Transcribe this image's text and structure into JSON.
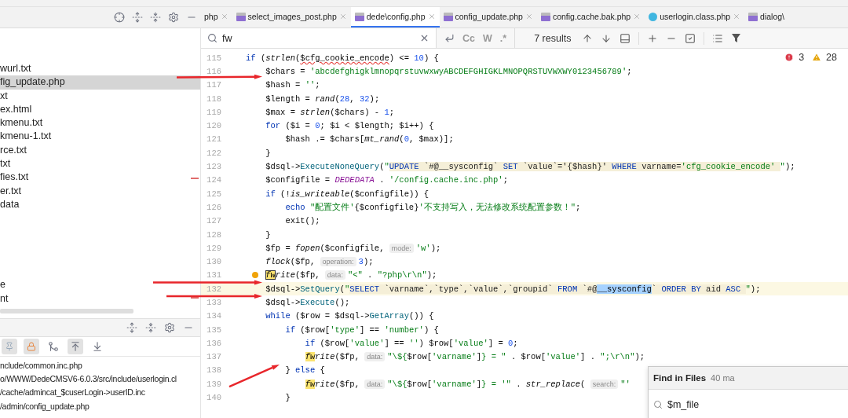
{
  "tabs": [
    {
      "label": "php",
      "selected": false
    },
    {
      "label": "select_images_post.php",
      "kind": "php",
      "selected": false
    },
    {
      "label": "dede\\config.php",
      "kind": "php",
      "selected": true
    },
    {
      "label": "config_update.php",
      "kind": "php",
      "selected": false
    },
    {
      "label": "config.cache.bak.php",
      "kind": "php",
      "selected": false
    },
    {
      "label": "userlogin.class.php",
      "kind": "class",
      "selected": false
    },
    {
      "label": "dialog\\",
      "kind": "php",
      "selected": false
    }
  ],
  "find_bar": {
    "query": "fw",
    "options": [
      "Cc",
      "W",
      ".*"
    ],
    "results": "7 results"
  },
  "inspections": {
    "errors": "3",
    "warnings": "28"
  },
  "project_files": {
    "items": [
      {
        "label": "wurl.txt",
        "selected": false
      },
      {
        "label": "fig_update.php",
        "selected": true
      },
      {
        "label": "xt",
        "selected": false
      },
      {
        "label": "ex.html",
        "selected": false
      },
      {
        "label": "kmenu.txt",
        "selected": false
      },
      {
        "label": "kmenu-1.txt",
        "selected": false
      },
      {
        "label": "rce.txt",
        "selected": false
      },
      {
        "label": "txt",
        "selected": false
      },
      {
        "label": "fies.txt",
        "selected": false
      },
      {
        "label": "er.txt",
        "selected": false
      },
      {
        "label": "data",
        "selected": false
      }
    ],
    "more_items": [
      {
        "label": "e",
        "selected": false
      },
      {
        "label": "nt",
        "selected": false
      }
    ]
  },
  "find_results": {
    "items": [
      "nclude/common.inc.php",
      "o/WWW/DedeCMSV6-6.0.3/src/include/userlogin.cl",
      "/cache/admincat_$cuserLogin->userID.inc",
      "/admin/config_update.php"
    ]
  },
  "editor": {
    "lines": [
      {
        "number": "115",
        "current": false,
        "tokens": [
          {
            "text": "if",
            "kind": "keyword"
          },
          {
            "text": " (",
            "kind": "plain"
          },
          {
            "text": "strlen",
            "kind": "call"
          },
          {
            "text": "(",
            "kind": "plain"
          },
          {
            "text": "$cfg_cookie_encode",
            "kind": "warning"
          },
          {
            "text": ") <= ",
            "kind": "plain"
          },
          {
            "text": "10",
            "kind": "number"
          },
          {
            "text": ") {",
            "kind": "plain"
          }
        ]
      },
      {
        "number": "116",
        "current": false,
        "tokens": [
          {
            "text": "    $chars = ",
            "kind": "plain"
          },
          {
            "text": "'abcdefghigklmnopqrstuvwxwyABCDEFGHIGKLMNOPQRSTUVWXWY0123456789'",
            "kind": "string"
          },
          {
            "text": ";",
            "kind": "plain"
          }
        ]
      },
      {
        "number": "117",
        "current": false,
        "tokens": [
          {
            "text": "    $hash = ",
            "kind": "plain"
          },
          {
            "text": "''",
            "kind": "string"
          },
          {
            "text": ";",
            "kind": "plain"
          }
        ]
      },
      {
        "number": "118",
        "current": false,
        "tokens": [
          {
            "text": "    $length = ",
            "kind": "plain"
          },
          {
            "text": "rand",
            "kind": "call"
          },
          {
            "text": "(",
            "kind": "plain"
          },
          {
            "text": "28",
            "kind": "number"
          },
          {
            "text": ", ",
            "kind": "plain"
          },
          {
            "text": "32",
            "kind": "number"
          },
          {
            "text": ");",
            "kind": "plain"
          }
        ]
      },
      {
        "number": "119",
        "current": false,
        "tokens": [
          {
            "text": "    $max = ",
            "kind": "plain"
          },
          {
            "text": "strlen",
            "kind": "call"
          },
          {
            "text": "($chars) - ",
            "kind": "plain"
          },
          {
            "text": "1",
            "kind": "number"
          },
          {
            "text": ";",
            "kind": "plain"
          }
        ]
      },
      {
        "number": "120",
        "current": false,
        "tokens": [
          {
            "text": "    for",
            "kind": "keyword"
          },
          {
            "text": " ($i = ",
            "kind": "plain"
          },
          {
            "text": "0",
            "kind": "number"
          },
          {
            "text": "; $i < $length; $i++) {",
            "kind": "plain"
          }
        ]
      },
      {
        "number": "121",
        "current": false,
        "tokens": [
          {
            "text": "        $hash .= $chars[",
            "kind": "plain"
          },
          {
            "text": "mt_rand",
            "kind": "call"
          },
          {
            "text": "(",
            "kind": "plain"
          },
          {
            "text": "0",
            "kind": "number"
          },
          {
            "text": ", $max)];",
            "kind": "plain"
          }
        ]
      },
      {
        "number": "122",
        "current": false,
        "tokens": [
          {
            "text": "    }",
            "kind": "plain"
          }
        ]
      },
      {
        "number": "123",
        "current": false,
        "tokens": [
          {
            "text": "    $dsql->",
            "kind": "plain"
          },
          {
            "text": "ExecuteNoneQuery",
            "kind": "method"
          },
          {
            "text": "(",
            "kind": "plain"
          },
          {
            "text": "\"",
            "kind": "string"
          },
          {
            "text": "UPDATE",
            "kind": "sql_keyword"
          },
          {
            "text": " `#@__sysconfig` ",
            "kind": "sql"
          },
          {
            "text": "SET",
            "kind": "sql_keyword"
          },
          {
            "text": " `value`='{$hash}' ",
            "kind": "sql"
          },
          {
            "text": "WHERE",
            "kind": "sql_keyword"
          },
          {
            "text": " varname=",
            "kind": "sql"
          },
          {
            "text": "'cfg_cookie_encode' ",
            "kind": "sql_string"
          },
          {
            "text": "\"",
            "kind": "string"
          },
          {
            "text": ");",
            "kind": "plain"
          }
        ]
      },
      {
        "number": "124",
        "current": false,
        "tokens": [
          {
            "text": "    $configfile = ",
            "kind": "plain"
          },
          {
            "text": "DEDEDATA",
            "kind": "constant"
          },
          {
            "text": " . ",
            "kind": "plain"
          },
          {
            "text": "'/config.cache.inc.php'",
            "kind": "string"
          },
          {
            "text": ";",
            "kind": "plain"
          }
        ]
      },
      {
        "number": "125",
        "current": false,
        "tokens": [
          {
            "text": "    if",
            "kind": "keyword"
          },
          {
            "text": " (!",
            "kind": "plain"
          },
          {
            "text": "is_writeable",
            "kind": "call"
          },
          {
            "text": "($configfile)) {",
            "kind": "plain"
          }
        ]
      },
      {
        "number": "126",
        "current": false,
        "tokens": [
          {
            "text": "        echo ",
            "kind": "keyword"
          },
          {
            "text": "\"配置文件'",
            "kind": "string"
          },
          {
            "text": "{$configfile}",
            "kind": "plain"
          },
          {
            "text": "'不支持写入，无法修改系统配置参数！\"",
            "kind": "string"
          },
          {
            "text": ";",
            "kind": "plain"
          }
        ]
      },
      {
        "number": "127",
        "current": false,
        "tokens": [
          {
            "text": "        exit();",
            "kind": "plain"
          }
        ]
      },
      {
        "number": "128",
        "current": false,
        "tokens": [
          {
            "text": "    }",
            "kind": "plain"
          }
        ]
      },
      {
        "number": "129",
        "current": false,
        "tokens": [
          {
            "text": "    $fp = ",
            "kind": "plain"
          },
          {
            "text": "fopen",
            "kind": "call"
          },
          {
            "text": "($configfile, ",
            "kind": "plain"
          },
          {
            "text": "mode:",
            "kind": "hint"
          },
          {
            "text": "'w'",
            "kind": "string"
          },
          {
            "text": ");",
            "kind": "plain"
          }
        ]
      },
      {
        "number": "130",
        "current": false,
        "tokens": [
          {
            "text": "    flock",
            "kind": "call"
          },
          {
            "text": "($fp, ",
            "kind": "plain"
          },
          {
            "text": "operation:",
            "kind": "hint"
          },
          {
            "text": "3",
            "kind": "number"
          },
          {
            "text": ");",
            "kind": "plain"
          }
        ]
      },
      {
        "number": "131",
        "current": false,
        "tokens": [
          {
            "text": "    fw",
            "kind": "current_match"
          },
          {
            "text": "rite",
            "kind": "call"
          },
          {
            "text": "($fp, ",
            "kind": "plain"
          },
          {
            "text": "data:",
            "kind": "hint"
          },
          {
            "text": "\"<\"",
            "kind": "string"
          },
          {
            "text": " . ",
            "kind": "plain"
          },
          {
            "text": "\"?php\\r\\n\"",
            "kind": "string"
          },
          {
            "text": ");",
            "kind": "plain"
          }
        ]
      },
      {
        "number": "132",
        "current": true,
        "tokens": [
          {
            "text": "    $dsql->",
            "kind": "plain"
          },
          {
            "text": "SetQuery",
            "kind": "method"
          },
          {
            "text": "(",
            "kind": "plain"
          },
          {
            "text": "\"",
            "kind": "string"
          },
          {
            "text": "SELECT",
            "kind": "sql_keyword"
          },
          {
            "text": " `varname`,`type`,`value`,`groupid` ",
            "kind": "sql"
          },
          {
            "text": "FROM",
            "kind": "sql_keyword"
          },
          {
            "text": " `#@",
            "kind": "sql"
          },
          {
            "text": "__sysconfig",
            "kind": "selection"
          },
          {
            "text": "` ",
            "kind": "sql"
          },
          {
            "text": "ORDER BY",
            "kind": "sql_keyword"
          },
          {
            "text": " aid ",
            "kind": "sql"
          },
          {
            "text": "ASC ",
            "kind": "sql_keyword"
          },
          {
            "text": "\"",
            "kind": "string"
          },
          {
            "text": ");",
            "kind": "plain"
          }
        ]
      },
      {
        "number": "133",
        "current": false,
        "tokens": [
          {
            "text": "    $dsql->",
            "kind": "plain"
          },
          {
            "text": "Execute",
            "kind": "method"
          },
          {
            "text": "();",
            "kind": "plain"
          }
        ]
      },
      {
        "number": "134",
        "current": false,
        "tokens": [
          {
            "text": "    while",
            "kind": "keyword"
          },
          {
            "text": " ($row = $dsql->",
            "kind": "plain"
          },
          {
            "text": "GetArray",
            "kind": "method"
          },
          {
            "text": "()) {",
            "kind": "plain"
          }
        ]
      },
      {
        "number": "135",
        "current": false,
        "tokens": [
          {
            "text": "        if",
            "kind": "keyword"
          },
          {
            "text": " ($row[",
            "kind": "plain"
          },
          {
            "text": "'type'",
            "kind": "string"
          },
          {
            "text": "] == ",
            "kind": "plain"
          },
          {
            "text": "'number'",
            "kind": "string"
          },
          {
            "text": ") {",
            "kind": "plain"
          }
        ]
      },
      {
        "number": "136",
        "current": false,
        "tokens": [
          {
            "text": "            if",
            "kind": "keyword"
          },
          {
            "text": " ($row[",
            "kind": "plain"
          },
          {
            "text": "'value'",
            "kind": "string"
          },
          {
            "text": "] == ",
            "kind": "plain"
          },
          {
            "text": "''",
            "kind": "string"
          },
          {
            "text": ") $row[",
            "kind": "plain"
          },
          {
            "text": "'value'",
            "kind": "string"
          },
          {
            "text": "] = ",
            "kind": "plain"
          },
          {
            "text": "0",
            "kind": "number"
          },
          {
            "text": ";",
            "kind": "plain"
          }
        ]
      },
      {
        "number": "137",
        "current": false,
        "tokens": [
          {
            "text": "            fw",
            "kind": "match"
          },
          {
            "text": "rite",
            "kind": "call"
          },
          {
            "text": "($fp, ",
            "kind": "plain"
          },
          {
            "text": "data:",
            "kind": "hint"
          },
          {
            "text": "\"\\${",
            "kind": "string"
          },
          {
            "text": "$row[",
            "kind": "plain"
          },
          {
            "text": "'varname'",
            "kind": "string"
          },
          {
            "text": "]",
            "kind": "plain"
          },
          {
            "text": "} = \"",
            "kind": "string"
          },
          {
            "text": " . $row[",
            "kind": "plain"
          },
          {
            "text": "'value'",
            "kind": "string"
          },
          {
            "text": "] . ",
            "kind": "plain"
          },
          {
            "text": "\";\\r\\n\"",
            "kind": "string"
          },
          {
            "text": ");",
            "kind": "plain"
          }
        ]
      },
      {
        "number": "138",
        "current": false,
        "tokens": [
          {
            "text": "        } ",
            "kind": "plain"
          },
          {
            "text": "else",
            "kind": "keyword"
          },
          {
            "text": " {",
            "kind": "plain"
          }
        ]
      },
      {
        "number": "139",
        "current": false,
        "tokens": [
          {
            "text": "            fw",
            "kind": "match"
          },
          {
            "text": "rite",
            "kind": "call"
          },
          {
            "text": "($fp, ",
            "kind": "plain"
          },
          {
            "text": "data:",
            "kind": "hint"
          },
          {
            "text": "\"\\${",
            "kind": "string"
          },
          {
            "text": "$row[",
            "kind": "plain"
          },
          {
            "text": "'varname'",
            "kind": "string"
          },
          {
            "text": "]",
            "kind": "plain"
          },
          {
            "text": "} = '\"",
            "kind": "string"
          },
          {
            "text": " . ",
            "kind": "plain"
          },
          {
            "text": "str_replace",
            "kind": "call"
          },
          {
            "text": "( ",
            "kind": "plain"
          },
          {
            "text": "search:",
            "kind": "hint"
          },
          {
            "text": "\"'",
            "kind": "string"
          }
        ]
      },
      {
        "number": "140",
        "current": false,
        "tokens": [
          {
            "text": "        }",
            "kind": "plain"
          }
        ]
      }
    ]
  },
  "find_in_files": {
    "title": "Find in Files",
    "count": "40 ma",
    "query": "$m_file"
  }
}
